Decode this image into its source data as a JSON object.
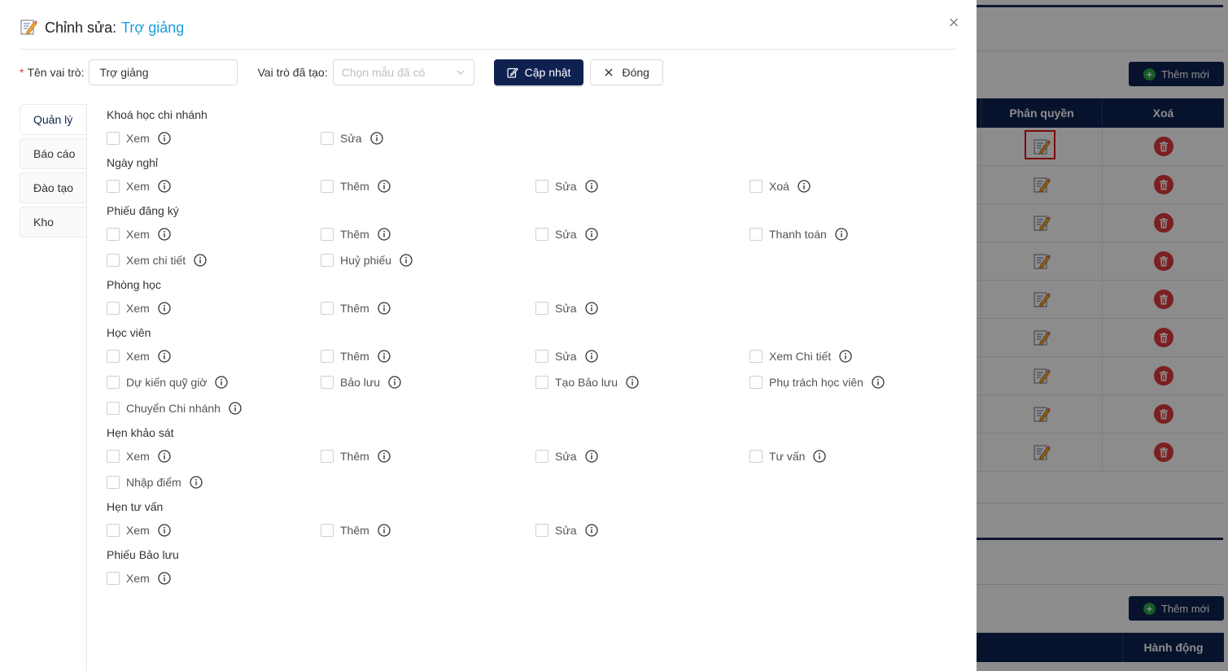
{
  "modal": {
    "title_prefix": "Chỉnh sửa:",
    "role_name": "Trợ giảng",
    "close_symbol": "×",
    "form": {
      "role_label": "Tên vai trò:",
      "role_value": "Trợ giảng",
      "template_label": "Vai trò đã tạo:",
      "template_placeholder": "Chọn mẫu đã có",
      "update_button": "Cập nhật",
      "close_button": "Đóng"
    },
    "tabs": [
      {
        "label": "Quản lý",
        "active": true
      },
      {
        "label": "Báo cáo",
        "active": false
      },
      {
        "label": "Đào tạo",
        "active": false
      },
      {
        "label": "Kho",
        "active": false
      }
    ],
    "groups": [
      {
        "title": "Khoá học chi nhánh",
        "items": [
          "Xem",
          "Sửa"
        ]
      },
      {
        "title": "Ngày nghỉ",
        "items": [
          "Xem",
          "Thêm",
          "Sửa",
          "Xoá"
        ]
      },
      {
        "title": "Phiếu đăng ký",
        "items": [
          "Xem",
          "Thêm",
          "Sửa",
          "Thanh toán",
          "Xem chi tiết",
          "Huỷ phiếu"
        ]
      },
      {
        "title": "Phòng học",
        "items": [
          "Xem",
          "Thêm",
          "Sửa"
        ]
      },
      {
        "title": "Học viên",
        "items": [
          "Xem",
          "Thêm",
          "Sửa",
          "Xem Chi tiết",
          "Dự kiến quỹ giờ",
          "Bảo lưu",
          "Tạo Bảo lưu",
          "Phụ trách học viên",
          "Chuyển Chi nhánh"
        ]
      },
      {
        "title": "Hẹn khảo sát",
        "items": [
          "Xem",
          "Thêm",
          "Sửa",
          "Tư vấn",
          "Nhập điểm"
        ]
      },
      {
        "title": "Hẹn tư vấn",
        "items": [
          "Xem",
          "Thêm",
          "Sửa"
        ]
      },
      {
        "title": "Phiếu Bảo lưu",
        "items": [
          "Xem"
        ]
      }
    ]
  },
  "background": {
    "add_button_top": "Thêm mới",
    "add_button_bottom": "Thêm mới",
    "table_headers": [
      "Phân quyền",
      "Xoá"
    ],
    "table_rows": 9,
    "bottom_header": "Hành động"
  },
  "colors": {
    "navy": "#0e2150",
    "accent_blue": "#1a9ed8",
    "danger_red": "#e0393e",
    "required_red": "#e23b3b"
  }
}
